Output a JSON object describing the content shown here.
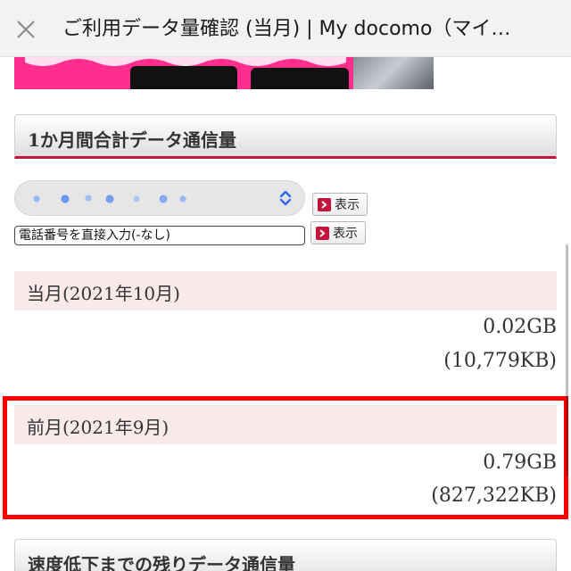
{
  "header": {
    "title": "ご利用データ量確認 (当月) | My docomo（マイ…"
  },
  "section_total": {
    "title": "1か月間合計データ通信量"
  },
  "line_select": {
    "show_button_label": "表示"
  },
  "phone_input": {
    "placeholder": "電話番号を直接入力(-なし)",
    "show_button_label": "表示"
  },
  "current_month": {
    "label": "当月(2021年10月)",
    "gb": "0.02GB",
    "kb": "(10,779KB)"
  },
  "previous_month": {
    "label": "前月(2021年9月)",
    "gb": "0.79GB",
    "kb": "(827,322KB)"
  },
  "section_remaining": {
    "title": "速度低下までの残りデータ通信量"
  },
  "colors": {
    "accent_red": "#c4143c",
    "highlight_red": "#ff0000",
    "month_header_bg": "#f8eaea",
    "banner_pink": "#ff2d8e"
  },
  "icons": {
    "close": "close-icon",
    "chevron": "chevron-updown-icon",
    "arrow": "arrow-right-icon"
  }
}
